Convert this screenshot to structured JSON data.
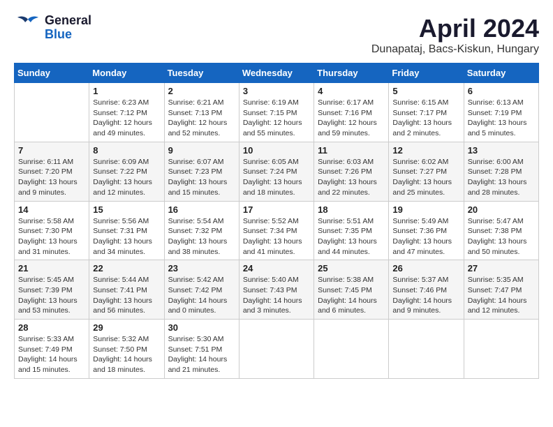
{
  "header": {
    "logo_general": "General",
    "logo_blue": "Blue",
    "month_title": "April 2024",
    "subtitle": "Dunapataj, Bacs-Kiskun, Hungary"
  },
  "weekdays": [
    "Sunday",
    "Monday",
    "Tuesday",
    "Wednesday",
    "Thursday",
    "Friday",
    "Saturday"
  ],
  "weeks": [
    [
      {
        "day": "",
        "info": ""
      },
      {
        "day": "1",
        "info": "Sunrise: 6:23 AM\nSunset: 7:12 PM\nDaylight: 12 hours\nand 49 minutes."
      },
      {
        "day": "2",
        "info": "Sunrise: 6:21 AM\nSunset: 7:13 PM\nDaylight: 12 hours\nand 52 minutes."
      },
      {
        "day": "3",
        "info": "Sunrise: 6:19 AM\nSunset: 7:15 PM\nDaylight: 12 hours\nand 55 minutes."
      },
      {
        "day": "4",
        "info": "Sunrise: 6:17 AM\nSunset: 7:16 PM\nDaylight: 12 hours\nand 59 minutes."
      },
      {
        "day": "5",
        "info": "Sunrise: 6:15 AM\nSunset: 7:17 PM\nDaylight: 13 hours\nand 2 minutes."
      },
      {
        "day": "6",
        "info": "Sunrise: 6:13 AM\nSunset: 7:19 PM\nDaylight: 13 hours\nand 5 minutes."
      }
    ],
    [
      {
        "day": "7",
        "info": "Sunrise: 6:11 AM\nSunset: 7:20 PM\nDaylight: 13 hours\nand 9 minutes."
      },
      {
        "day": "8",
        "info": "Sunrise: 6:09 AM\nSunset: 7:22 PM\nDaylight: 13 hours\nand 12 minutes."
      },
      {
        "day": "9",
        "info": "Sunrise: 6:07 AM\nSunset: 7:23 PM\nDaylight: 13 hours\nand 15 minutes."
      },
      {
        "day": "10",
        "info": "Sunrise: 6:05 AM\nSunset: 7:24 PM\nDaylight: 13 hours\nand 18 minutes."
      },
      {
        "day": "11",
        "info": "Sunrise: 6:03 AM\nSunset: 7:26 PM\nDaylight: 13 hours\nand 22 minutes."
      },
      {
        "day": "12",
        "info": "Sunrise: 6:02 AM\nSunset: 7:27 PM\nDaylight: 13 hours\nand 25 minutes."
      },
      {
        "day": "13",
        "info": "Sunrise: 6:00 AM\nSunset: 7:28 PM\nDaylight: 13 hours\nand 28 minutes."
      }
    ],
    [
      {
        "day": "14",
        "info": "Sunrise: 5:58 AM\nSunset: 7:30 PM\nDaylight: 13 hours\nand 31 minutes."
      },
      {
        "day": "15",
        "info": "Sunrise: 5:56 AM\nSunset: 7:31 PM\nDaylight: 13 hours\nand 34 minutes."
      },
      {
        "day": "16",
        "info": "Sunrise: 5:54 AM\nSunset: 7:32 PM\nDaylight: 13 hours\nand 38 minutes."
      },
      {
        "day": "17",
        "info": "Sunrise: 5:52 AM\nSunset: 7:34 PM\nDaylight: 13 hours\nand 41 minutes."
      },
      {
        "day": "18",
        "info": "Sunrise: 5:51 AM\nSunset: 7:35 PM\nDaylight: 13 hours\nand 44 minutes."
      },
      {
        "day": "19",
        "info": "Sunrise: 5:49 AM\nSunset: 7:36 PM\nDaylight: 13 hours\nand 47 minutes."
      },
      {
        "day": "20",
        "info": "Sunrise: 5:47 AM\nSunset: 7:38 PM\nDaylight: 13 hours\nand 50 minutes."
      }
    ],
    [
      {
        "day": "21",
        "info": "Sunrise: 5:45 AM\nSunset: 7:39 PM\nDaylight: 13 hours\nand 53 minutes."
      },
      {
        "day": "22",
        "info": "Sunrise: 5:44 AM\nSunset: 7:41 PM\nDaylight: 13 hours\nand 56 minutes."
      },
      {
        "day": "23",
        "info": "Sunrise: 5:42 AM\nSunset: 7:42 PM\nDaylight: 14 hours\nand 0 minutes."
      },
      {
        "day": "24",
        "info": "Sunrise: 5:40 AM\nSunset: 7:43 PM\nDaylight: 14 hours\nand 3 minutes."
      },
      {
        "day": "25",
        "info": "Sunrise: 5:38 AM\nSunset: 7:45 PM\nDaylight: 14 hours\nand 6 minutes."
      },
      {
        "day": "26",
        "info": "Sunrise: 5:37 AM\nSunset: 7:46 PM\nDaylight: 14 hours\nand 9 minutes."
      },
      {
        "day": "27",
        "info": "Sunrise: 5:35 AM\nSunset: 7:47 PM\nDaylight: 14 hours\nand 12 minutes."
      }
    ],
    [
      {
        "day": "28",
        "info": "Sunrise: 5:33 AM\nSunset: 7:49 PM\nDaylight: 14 hours\nand 15 minutes."
      },
      {
        "day": "29",
        "info": "Sunrise: 5:32 AM\nSunset: 7:50 PM\nDaylight: 14 hours\nand 18 minutes."
      },
      {
        "day": "30",
        "info": "Sunrise: 5:30 AM\nSunset: 7:51 PM\nDaylight: 14 hours\nand 21 minutes."
      },
      {
        "day": "",
        "info": ""
      },
      {
        "day": "",
        "info": ""
      },
      {
        "day": "",
        "info": ""
      },
      {
        "day": "",
        "info": ""
      }
    ]
  ]
}
